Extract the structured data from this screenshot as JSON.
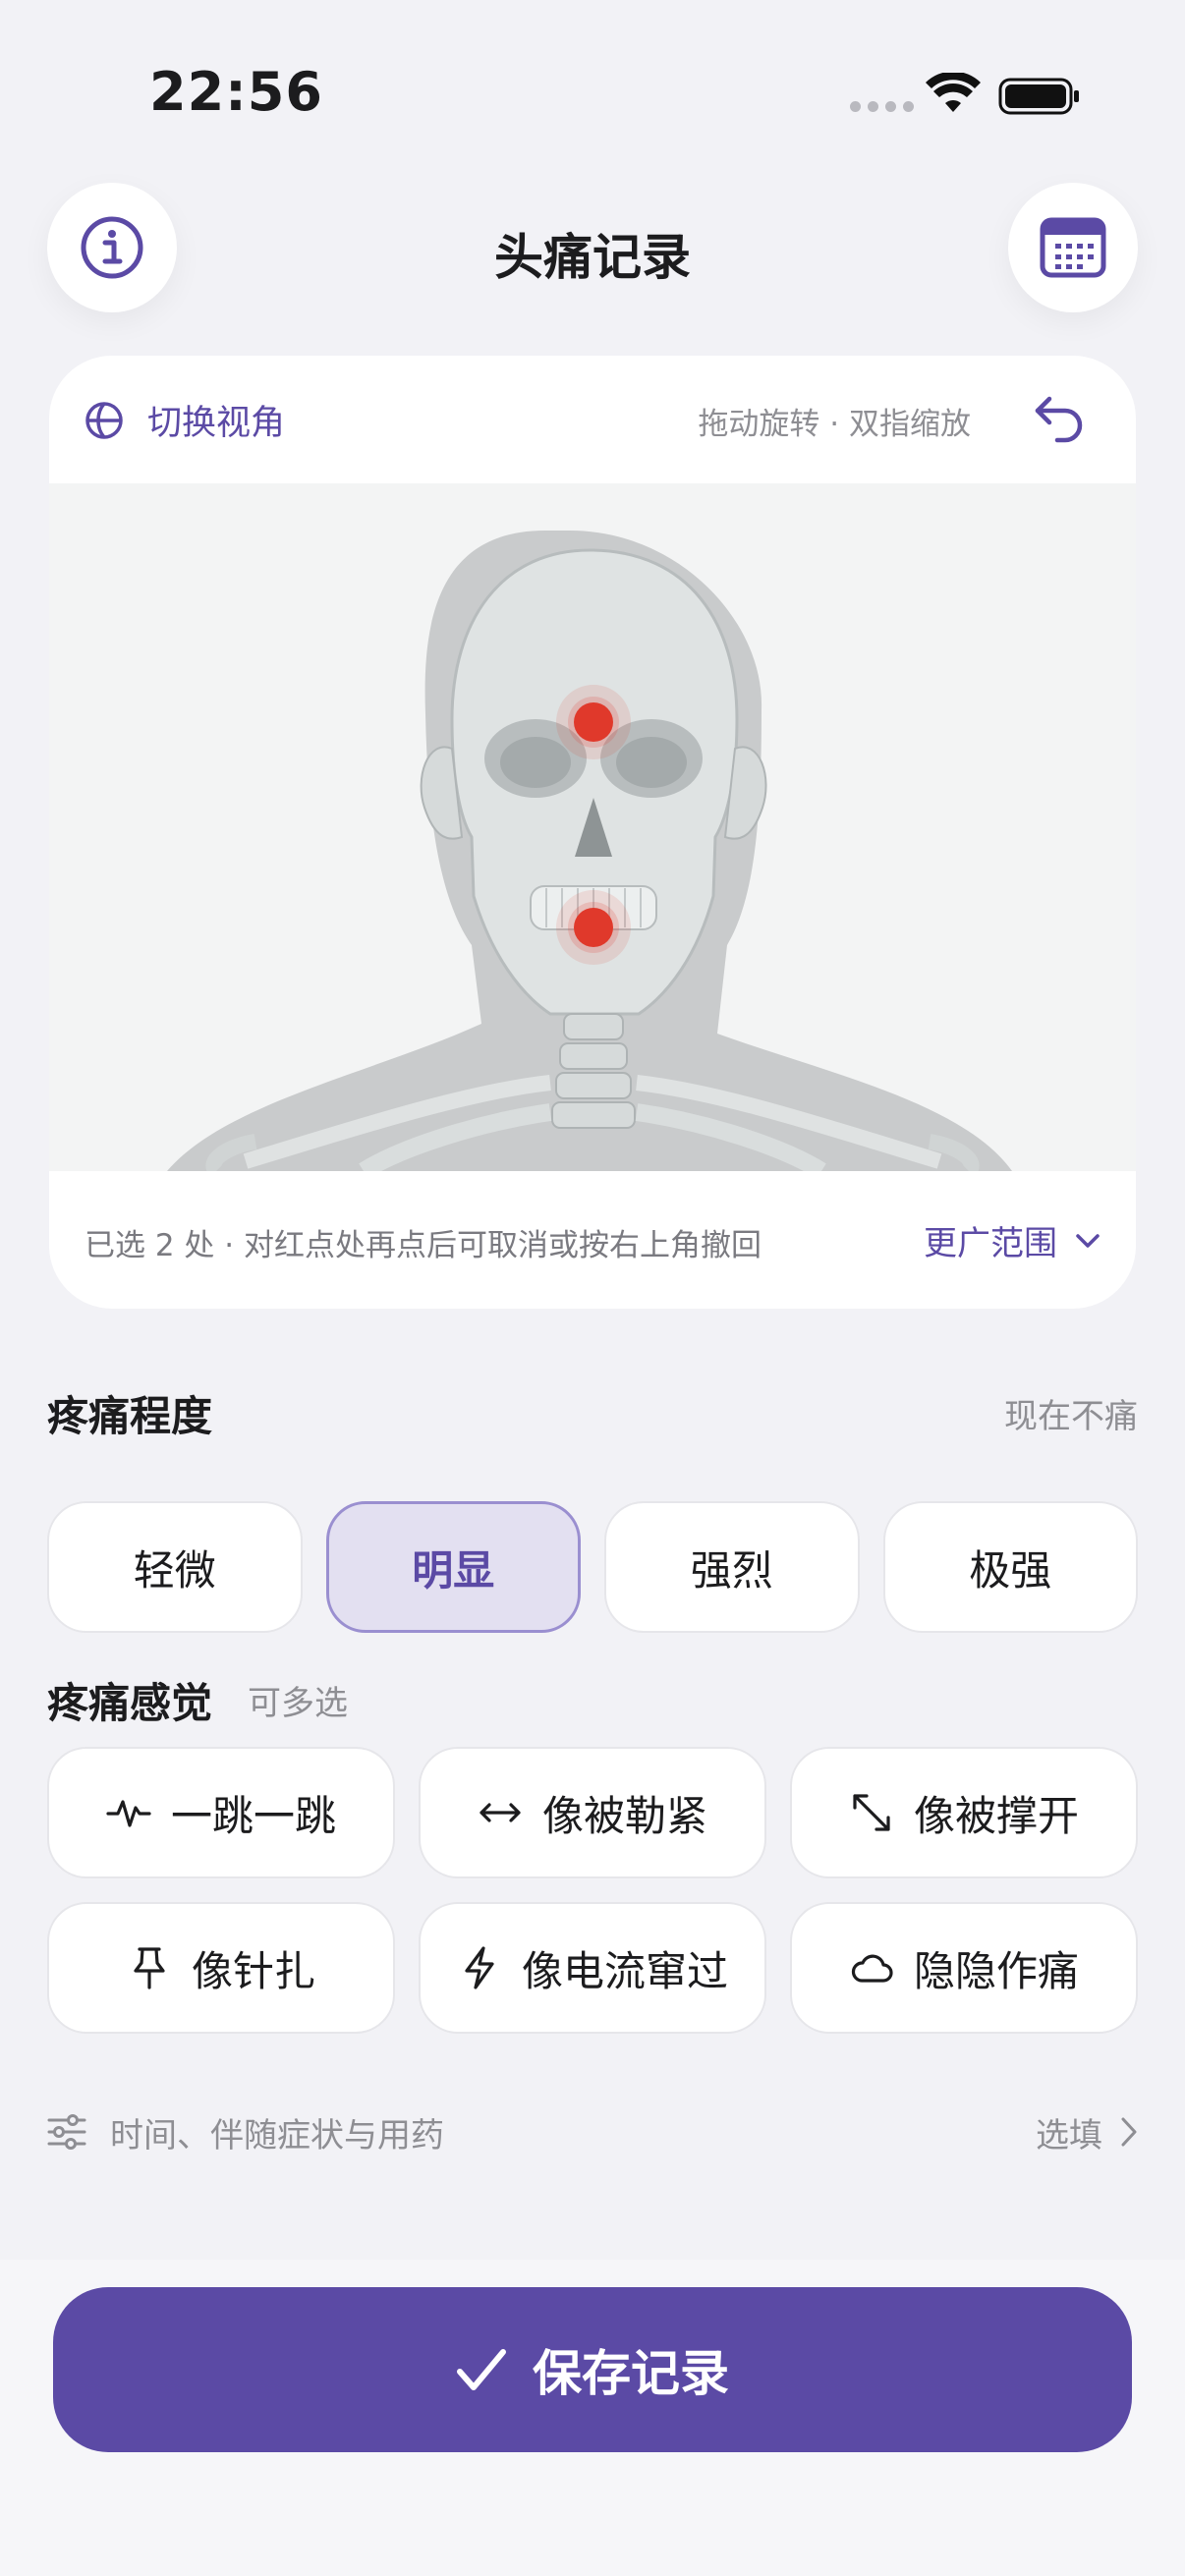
{
  "status_bar": {
    "time": "22:56"
  },
  "header": {
    "title": "头痛记录",
    "info_icon": "info-circle-icon",
    "calendar_icon": "calendar-icon"
  },
  "viewer": {
    "switch_label": "切换视角",
    "hint": "拖动旋转 · 双指缩放",
    "selection_info": "已选 2 处 · 对红点处再点后可取消或按右上角撤回",
    "range_label": "更广范围",
    "marker_color": "#e0392b"
  },
  "intensity": {
    "title": "疼痛程度",
    "none_label": "现在不痛",
    "options": [
      "轻微",
      "明显",
      "强烈",
      "极强"
    ],
    "selected": "明显"
  },
  "sensation": {
    "title": "疼痛感觉",
    "note": "可多选",
    "options": [
      {
        "label": "一跳一跳",
        "icon": "pulse-icon"
      },
      {
        "label": "像被勒紧",
        "icon": "arrows-horizontal-icon"
      },
      {
        "label": "像被撑开",
        "icon": "arrows-diagonal-icon"
      },
      {
        "label": "像针扎",
        "icon": "pin-icon"
      },
      {
        "label": "像电流窜过",
        "icon": "bolt-icon"
      },
      {
        "label": "隐隐作痛",
        "icon": "cloud-icon"
      }
    ]
  },
  "optional": {
    "label": "时间、伴随症状与用药",
    "right_label": "选填"
  },
  "save": {
    "label": "保存记录"
  },
  "colors": {
    "accent": "#5b4aa5",
    "selected_bg": "#e3e0f1",
    "background": "#f2f2f6"
  }
}
